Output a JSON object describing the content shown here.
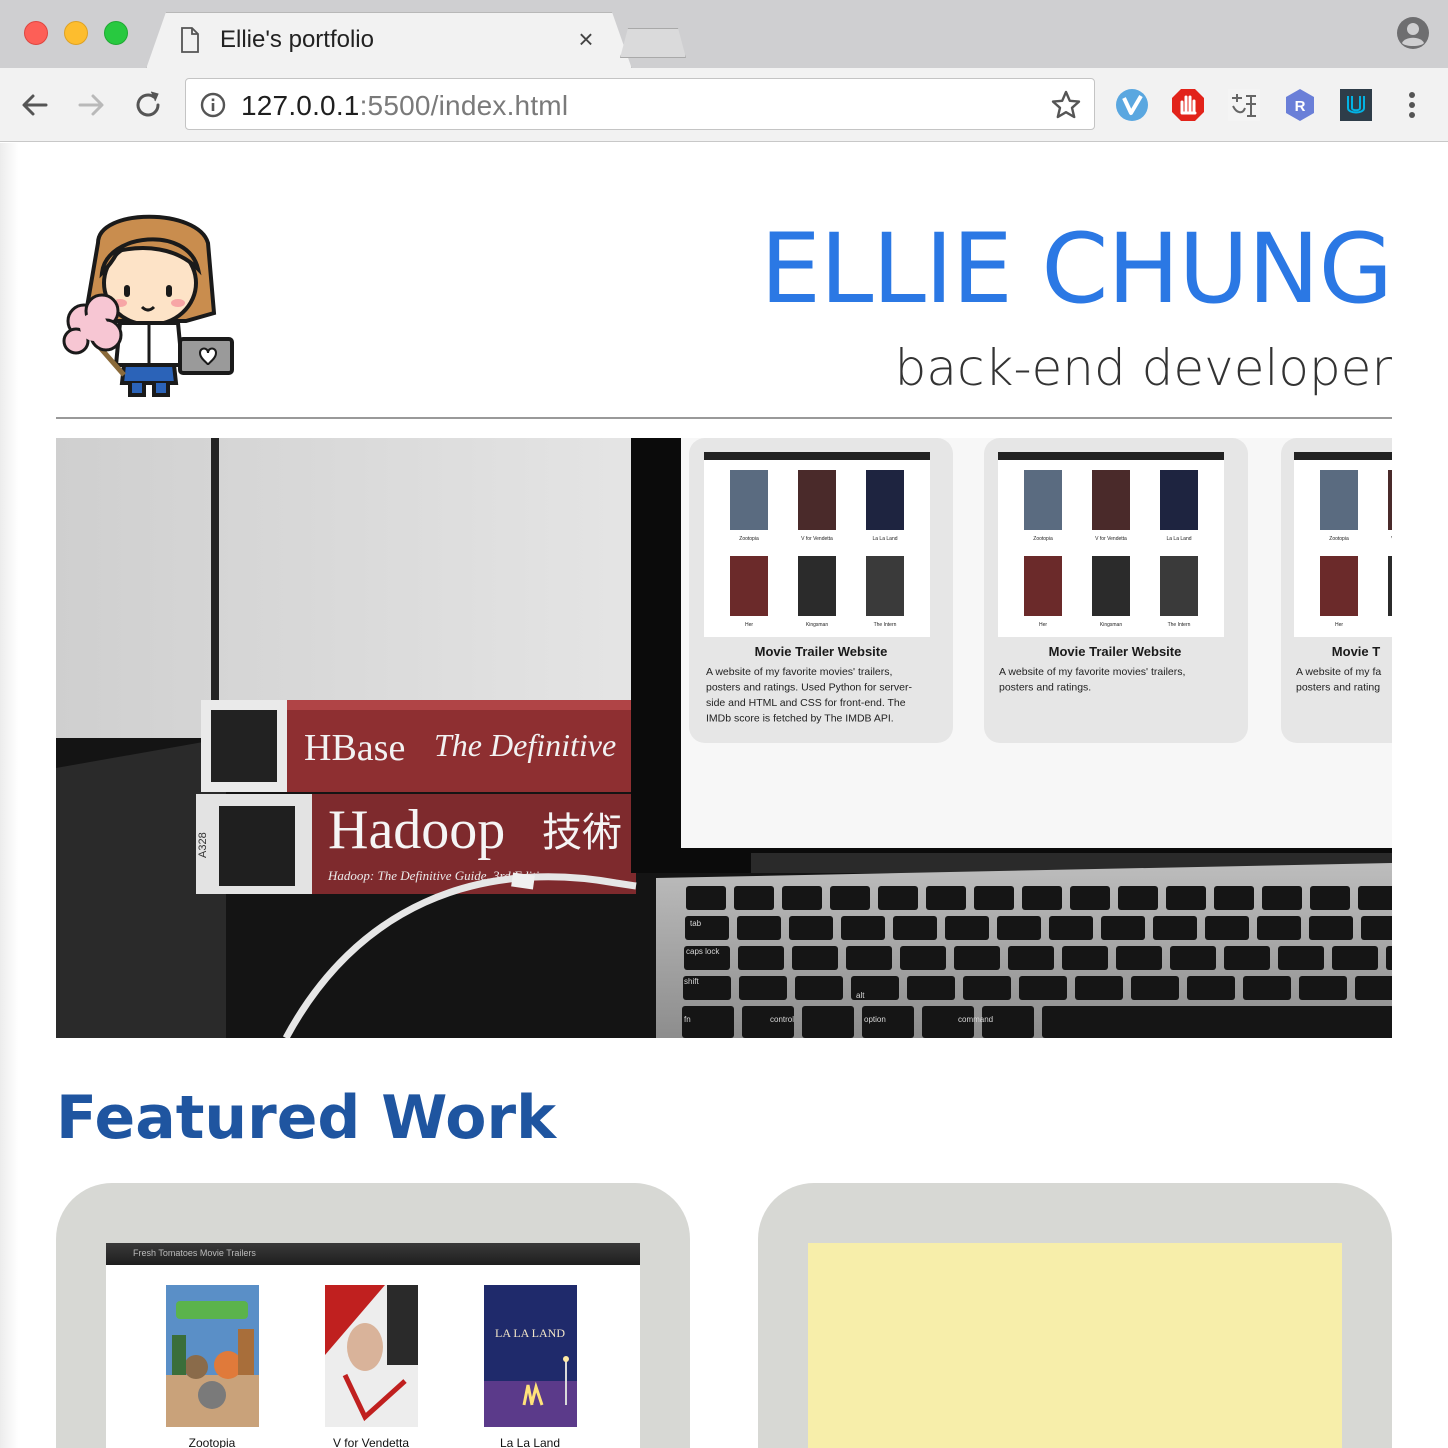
{
  "browser": {
    "tab_title": "Ellie's portfolio",
    "close_glyph": "×",
    "url_host": "127.0.0.1",
    "url_rest": ":5500/index.html",
    "extensions": [
      "vimium-icon",
      "adblock-icon",
      "translate-icon",
      "r-extension-icon",
      "udacity-icon"
    ]
  },
  "header": {
    "name": "ELLIE CHUNG",
    "role": "back-end developer"
  },
  "hero": {
    "book_top_title": "HBase",
    "book_top_subtitle": "The Definitive",
    "book_bottom_title": "Hadoop",
    "book_bottom_cjk": "技術",
    "book_bottom_caption": "Hadoop: The Definitive Guide, 3rd Edition",
    "book_spine_code": "A328",
    "screen_cards": [
      {
        "title": "Movie Trailer Website",
        "desc": [
          "A website of my favorite movies' trailers,",
          "posters and ratings. Used Python for server-",
          "side and HTML and CSS for front-end. The",
          "IMDb score is fetched by The IMDB API."
        ]
      },
      {
        "title": "Movie Trailer Website",
        "desc": [
          "A website of my favorite movies' trailers,",
          "posters and ratings."
        ]
      },
      {
        "title": "Movie T",
        "desc": [
          "A website of my fa",
          "posters and rating"
        ]
      }
    ],
    "movie_labels": [
      "Zootopia",
      "V for Vendetta",
      "La La Land",
      "Her",
      "Kingsman",
      "The Intern"
    ],
    "key_labels": [
      "tab",
      "caps lock",
      "shift",
      "fn",
      "control",
      "option",
      "command",
      "alt"
    ]
  },
  "featured": {
    "title": "Featured Work",
    "shot_bar_title": "Fresh Tomatoes Movie Trailers",
    "posters": [
      {
        "label": "Zootopia"
      },
      {
        "label": "V for Vendetta"
      },
      {
        "label": "La La Land"
      }
    ]
  },
  "colors": {
    "accent": "#2b78e4",
    "section_title": "#1f55a0",
    "card_bg": "#d7d8d4",
    "yellow_panel": "#f7eeaa"
  }
}
